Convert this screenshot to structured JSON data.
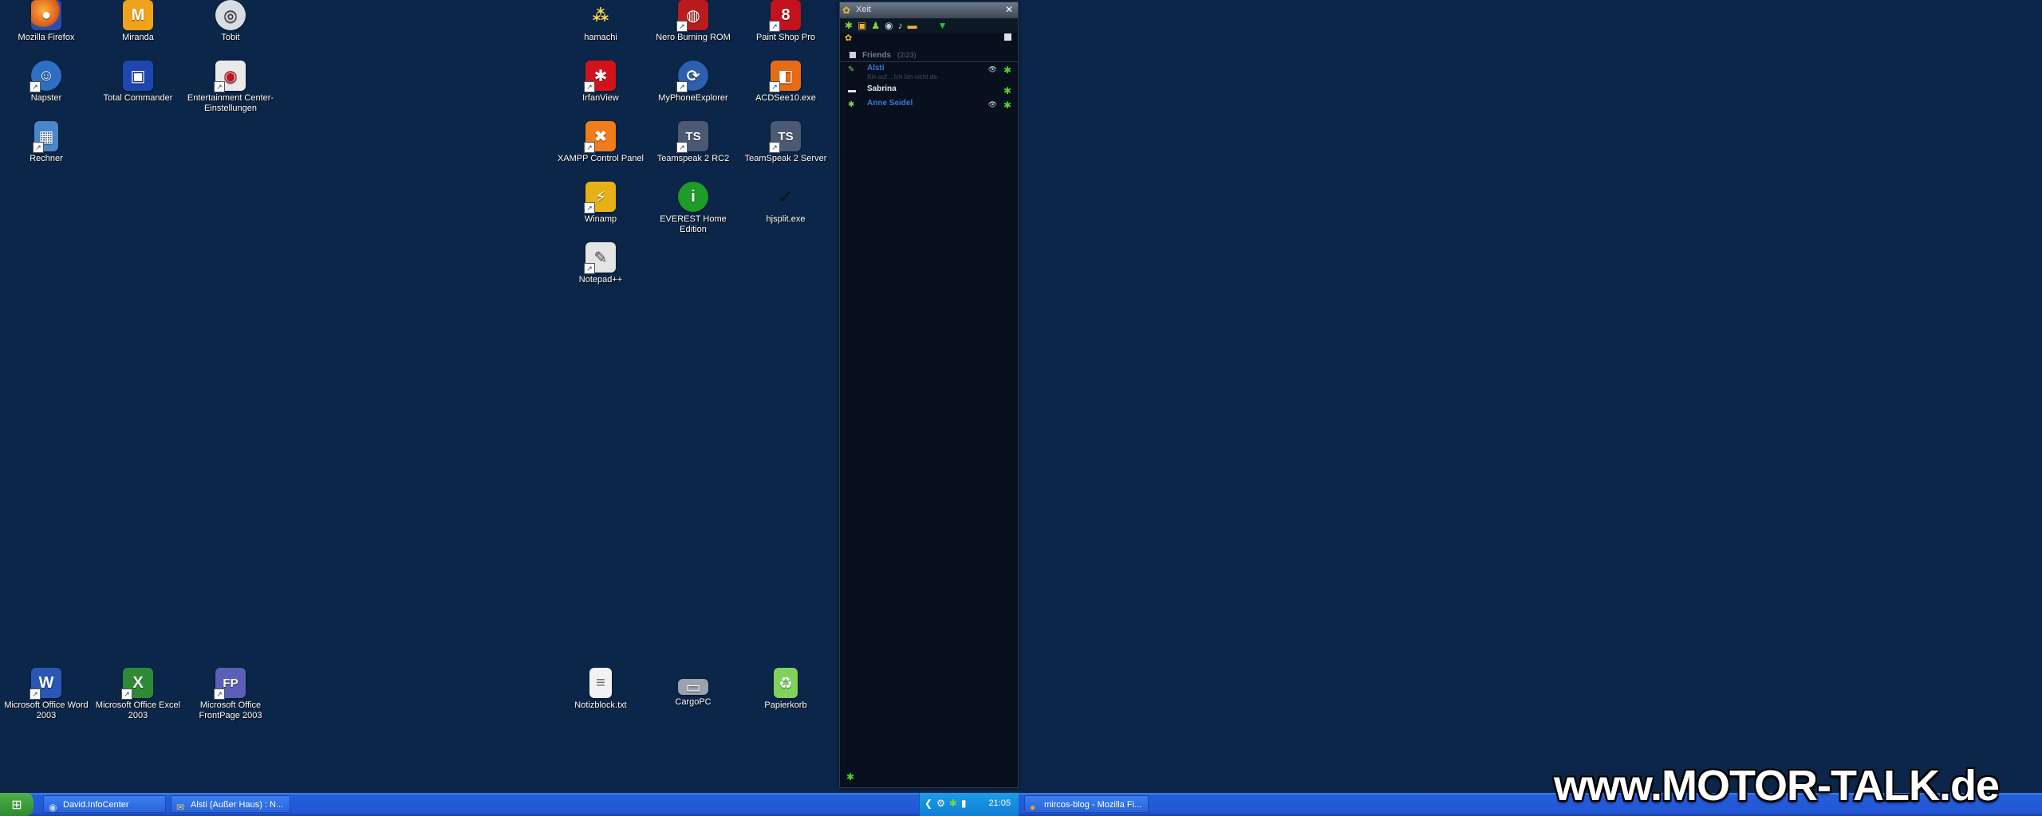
{
  "desktop": {
    "icons": [
      {
        "label": "Mozilla Firefox",
        "color": "#e8731e",
        "glyph": "●",
        "shortcut": false
      },
      {
        "label": "Miranda",
        "color": "#f0a21a",
        "glyph": "M",
        "shortcut": false
      },
      {
        "label": "Tobit",
        "color": "#d9dde3",
        "glyph": "◎",
        "shortcut": false
      },
      {
        "label": "Napster",
        "color": "#2f6fc3",
        "glyph": "☺",
        "shortcut": true
      },
      {
        "label": "Total Commander",
        "color": "#1e46b0",
        "glyph": "▣",
        "shortcut": false
      },
      {
        "label": "Entertainment Center-Einstellungen",
        "color": "#e9e9e9",
        "glyph": "◉",
        "shortcut": true
      },
      {
        "label": "Rechner",
        "color": "#4a86c8",
        "glyph": "▦",
        "shortcut": true
      },
      {
        "label": "hamachi",
        "color": "#0b2648",
        "glyph": "⁂",
        "shortcut": false
      },
      {
        "label": "Nero Burning ROM",
        "color": "#b81c1c",
        "glyph": "◍",
        "shortcut": true
      },
      {
        "label": "Paint Shop Pro",
        "color": "#c2121b",
        "glyph": "8",
        "shortcut": true
      },
      {
        "label": "IrfanView",
        "color": "#d3121b",
        "glyph": "✱",
        "shortcut": true
      },
      {
        "label": "MyPhoneExplorer",
        "color": "#2c5fae",
        "glyph": "⟳",
        "shortcut": true
      },
      {
        "label": "ACDSee10.exe",
        "color": "#e76a17",
        "glyph": "◧",
        "shortcut": true
      },
      {
        "label": "XAMPP Control Panel",
        "color": "#f07d1a",
        "glyph": "✖",
        "shortcut": true
      },
      {
        "label": "Teamspeak 2 RC2",
        "color": "#4b5a72",
        "glyph": "TS",
        "shortcut": true
      },
      {
        "label": "TeamSpeak 2 Server",
        "color": "#4b5a72",
        "glyph": "TS",
        "shortcut": true
      },
      {
        "label": "Winamp",
        "color": "#e8b017",
        "glyph": "⚡",
        "shortcut": true
      },
      {
        "label": "EVEREST Home Edition",
        "color": "#1f9b2a",
        "glyph": "i",
        "shortcut": false
      },
      {
        "label": "hjsplit.exe",
        "color": "#0b2648",
        "glyph": "✓",
        "shortcut": false
      },
      {
        "label": "Notepad++",
        "color": "#e4e4e4",
        "glyph": "✎",
        "shortcut": true
      },
      {
        "label": "Microsoft Office Word 2003",
        "color": "#2a56b5",
        "glyph": "W",
        "shortcut": true
      },
      {
        "label": "Microsoft Office Excel 2003",
        "color": "#2f8a37",
        "glyph": "X",
        "shortcut": true
      },
      {
        "label": "Microsoft Office FrontPage 2003",
        "color": "#5c5fb8",
        "glyph": "FP",
        "shortcut": true
      },
      {
        "label": "Notizblock.txt",
        "color": "#f2f2f2",
        "glyph": "≡",
        "shortcut": false
      },
      {
        "label": "CargoPC",
        "color": "#9aa3ad",
        "glyph": "▭",
        "shortcut": false
      },
      {
        "label": "Papierkorb",
        "color": "#7fd35b",
        "glyph": "♻",
        "shortcut": false
      }
    ]
  },
  "xeit": {
    "title": "Xeit",
    "close": "✕",
    "group": {
      "name": "Friends",
      "count": "(2/23)"
    },
    "contacts": [
      {
        "name": "Alsti",
        "status": "Bin auf... Ich bin nicht da",
        "color": "#3a7ad9"
      },
      {
        "name": "Sabrina",
        "status": "",
        "color": "#e6ebf0"
      },
      {
        "name": "Anne Seidel",
        "status": "",
        "color": "#3a7ad9"
      }
    ]
  },
  "taskbar": {
    "start_glyph": "⊞",
    "buttons": [
      {
        "label": "David.InfoCenter",
        "icon": "◉"
      },
      {
        "label": "Alsti (Außer Haus) : N...",
        "icon": "✉"
      },
      {
        "label": "mircos-blog - Mozilla Fi...",
        "icon": "●"
      }
    ],
    "clock": "21:05"
  },
  "watermark": "www.MOTOR-TALK.de"
}
